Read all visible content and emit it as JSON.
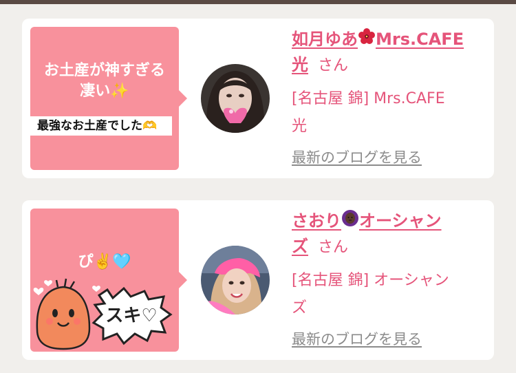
{
  "cards": [
    {
      "bubble": {
        "line1": "お土産が神すぎる",
        "line2": "凄い✨",
        "strip": "最強なお土産でした🫶"
      },
      "name_part1": "如月ゆあ",
      "name_part2": "Mrs.CAFE",
      "name_part3": "光",
      "san": "さん",
      "shop_line1": "[名古屋 錦] Mrs.CAFE",
      "shop_line2": "光",
      "blog_link": "最新のブログを見る"
    },
    {
      "bubble": {
        "line1": "ぴ✌️🩵",
        "sticker_text": "スキ♡"
      },
      "name_part1": "さおり",
      "name_part2": "オーシャン",
      "name_part3": "ズ",
      "san": "さん",
      "shop_line1": "[名古屋 錦] オーシャン",
      "shop_line2": "ズ",
      "blog_link": "最新のブログを見る"
    }
  ],
  "colors": {
    "accent": "#e5547a",
    "bubble": "#f8919c",
    "link_gray": "#8b8b8b"
  },
  "icons": [
    "hibiscus-icon",
    "woman-gesturing-no-icon",
    "heart-icon",
    "sparkles-icon",
    "victory-hand-icon",
    "heart-hands-icon"
  ]
}
